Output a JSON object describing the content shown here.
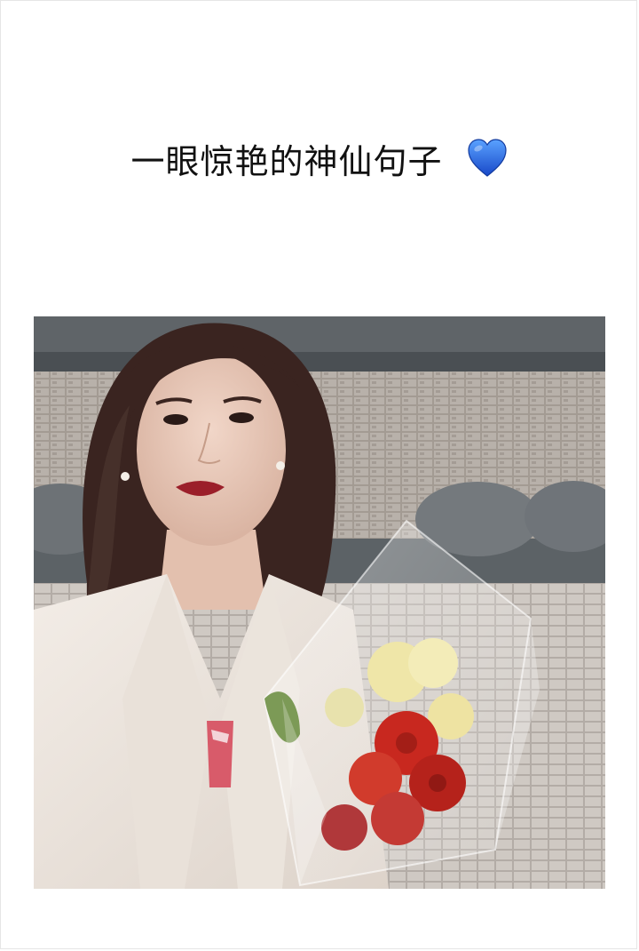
{
  "header": {
    "title": "一眼惊艳的神仙句子",
    "emoji_icon": "blue-heart-icon"
  },
  "photo": {
    "subject": "portrait-photo"
  },
  "colors": {
    "background": "#ffffff",
    "heart": "#2a6fe0",
    "lip": "#9b1f2a",
    "flowers_red": "#c8281f",
    "flowers_yellow": "#efe6a8"
  }
}
